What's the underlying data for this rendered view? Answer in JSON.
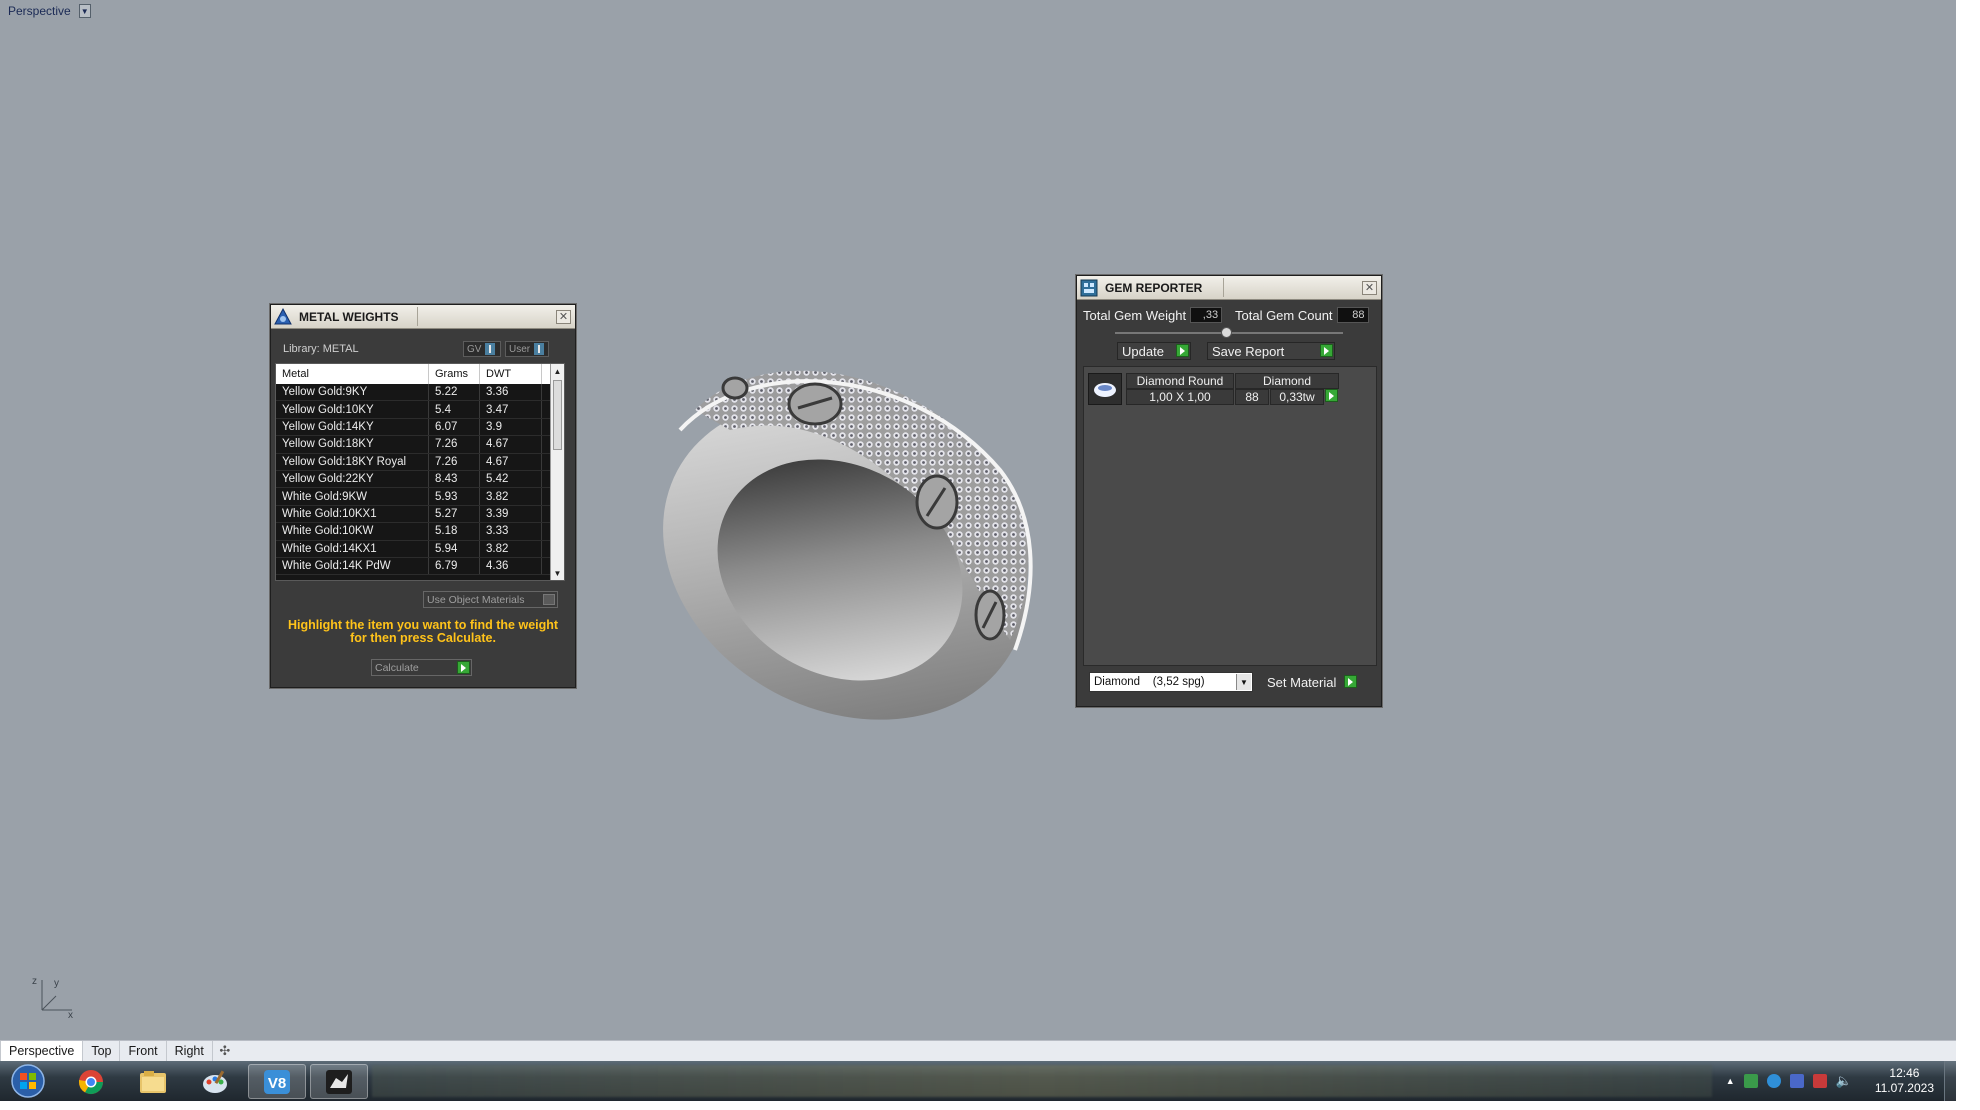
{
  "viewport": {
    "label": "Perspective",
    "axis_labels": {
      "x": "x",
      "y": "y",
      "z": "z"
    }
  },
  "metal_panel": {
    "title": "METAL WEIGHTS",
    "library_label": "Library: METAL",
    "toggle_gv": "GV",
    "toggle_user": "User",
    "columns": [
      "Metal",
      "Grams",
      "DWT"
    ],
    "rows": [
      [
        "Yellow Gold:9KY",
        "5.22",
        "3.36"
      ],
      [
        "Yellow Gold:10KY",
        "5.4",
        "3.47"
      ],
      [
        "Yellow Gold:14KY",
        "6.07",
        "3.9"
      ],
      [
        "Yellow Gold:18KY",
        "7.26",
        "4.67"
      ],
      [
        "Yellow Gold:18KY Royal",
        "7.26",
        "4.67"
      ],
      [
        "Yellow Gold:22KY",
        "8.43",
        "5.42"
      ],
      [
        "White Gold:9KW",
        "5.93",
        "3.82"
      ],
      [
        "White Gold:10KX1",
        "5.27",
        "3.39"
      ],
      [
        "White Gold:10KW",
        "5.18",
        "3.33"
      ],
      [
        "White Gold:14KX1",
        "5.94",
        "3.82"
      ],
      [
        "White Gold:14K PdW",
        "6.79",
        "4.36"
      ]
    ],
    "use_object_materials": "Use Object Materials",
    "hint": "Highlight the item you want to find the weight for then press Calculate.",
    "calculate_label": "Calculate"
  },
  "gem_panel": {
    "title": "GEM REPORTER",
    "total_weight_label": "Total Gem Weight",
    "total_weight_value": ",33",
    "total_count_label": "Total Gem Count",
    "total_count_value": "88",
    "update_label": "Update",
    "save_report_label": "Save Report",
    "gem": {
      "shape": "Diamond Round",
      "material": "Diamond",
      "size": "1,00 X 1,00",
      "count": "88",
      "weight": "0,33tw"
    },
    "material_select": "Diamond    (3,52 spg)",
    "set_material_label": "Set Material"
  },
  "view_tabs": [
    "Perspective",
    "Top",
    "Front",
    "Right"
  ],
  "taskbar": {
    "apps": [
      "chrome-icon",
      "explorer-icon",
      "paint-icon",
      "v8-icon",
      "rhino-icon"
    ],
    "time": "12:46",
    "date": "11.07.2023"
  },
  "colors": {
    "viewport_bg": "#9aa1a9",
    "panel_bg": "#3b3b3b",
    "hint_text": "#ffc31a",
    "green_button": "#36a836"
  }
}
